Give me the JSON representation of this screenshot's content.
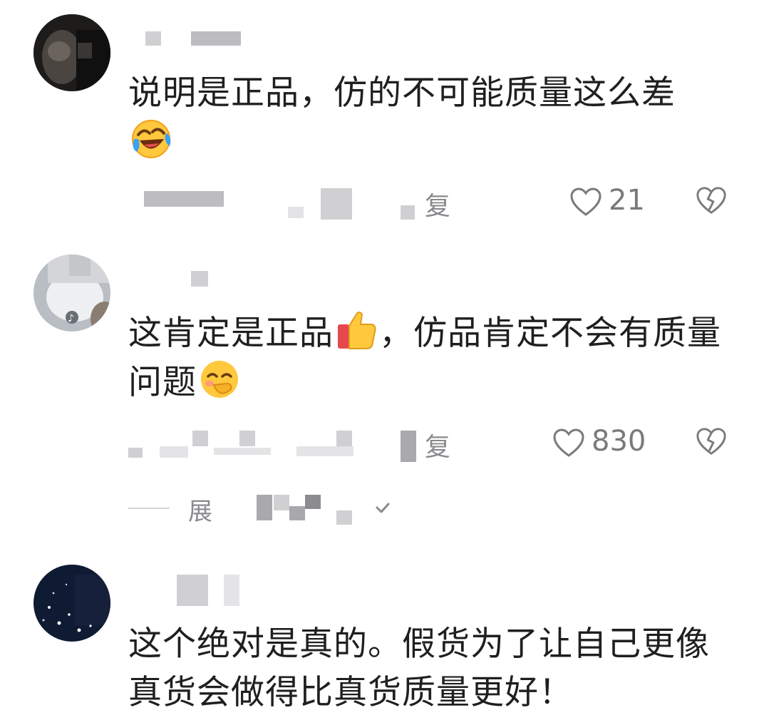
{
  "comments": [
    {
      "text": "说明是正品，仿的不可能质量这么差",
      "emoji": "face-with-tears-of-joy",
      "reply_label": "复",
      "likes": "21"
    },
    {
      "text_a": "这肯定是正品",
      "emoji_a": "thumbs-up",
      "text_b": "，仿品肯定不会有质量问题",
      "emoji_b": "smiling-face-hand-over-mouth",
      "reply_label": "复",
      "likes": "830",
      "expand_label": "展"
    },
    {
      "text": "这个绝对是真的。假货为了让自己更像真货会做得比真货质量更好！"
    }
  ],
  "colors": {
    "text": "#1f1f1f",
    "meta": "#8a8a8e",
    "icon": "#7a7a7e"
  }
}
